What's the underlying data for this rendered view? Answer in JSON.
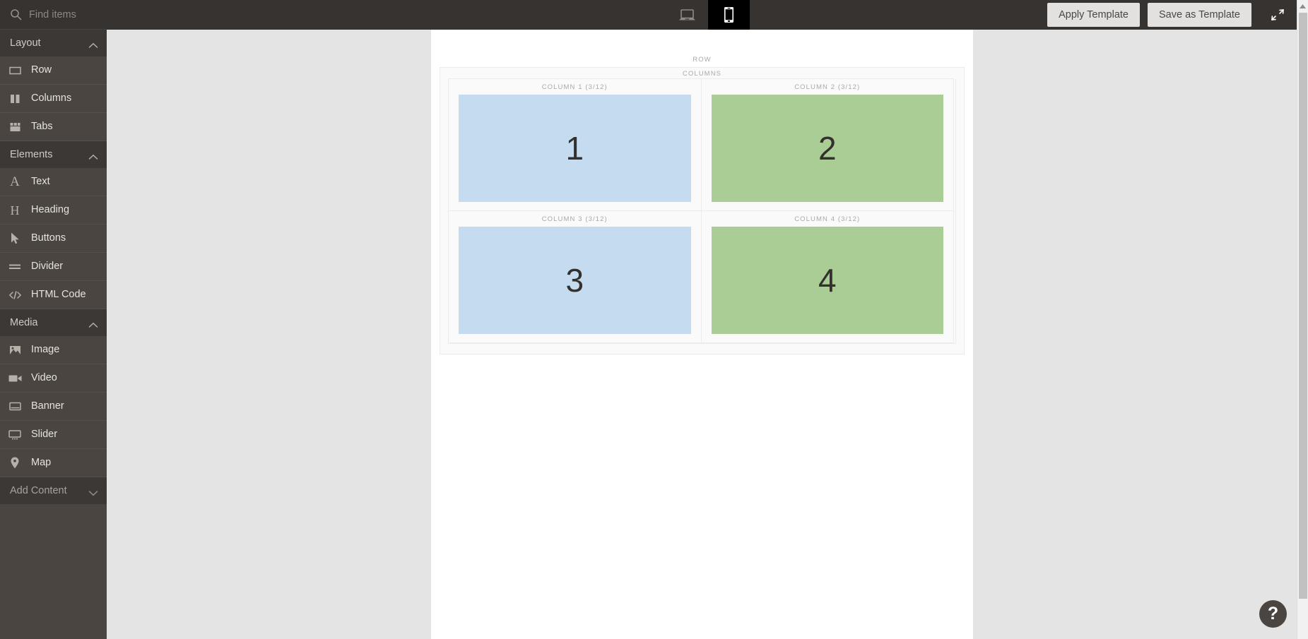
{
  "topbar": {
    "search": {
      "placeholder": "Find items",
      "value": "",
      "icon": "search-icon"
    },
    "viewport": {
      "desktop": {
        "label": "Desktop",
        "icon": "laptop-icon",
        "active": false
      },
      "mobile": {
        "label": "Mobile",
        "icon": "phone-icon",
        "active": true
      }
    },
    "apply_template_label": "Apply Template",
    "save_template_label": "Save as Template",
    "collapse_icon": "collapse-arrows-icon"
  },
  "sidebar": {
    "groups": [
      {
        "title": "Layout",
        "collapsed": false,
        "chevron": "chevron-up-icon",
        "items": [
          {
            "label": "Row",
            "icon": "row-icon"
          },
          {
            "label": "Columns",
            "icon": "columns-icon"
          },
          {
            "label": "Tabs",
            "icon": "tabs-icon"
          }
        ]
      },
      {
        "title": "Elements",
        "collapsed": false,
        "chevron": "chevron-up-icon",
        "items": [
          {
            "label": "Text",
            "icon": "text-a-icon"
          },
          {
            "label": "Heading",
            "icon": "heading-h-icon"
          },
          {
            "label": "Buttons",
            "icon": "cursor-arrow-icon"
          },
          {
            "label": "Divider",
            "icon": "divider-icon"
          },
          {
            "label": "HTML Code",
            "icon": "code-icon"
          }
        ]
      },
      {
        "title": "Media",
        "collapsed": false,
        "chevron": "chevron-up-icon",
        "items": [
          {
            "label": "Image",
            "icon": "image-icon"
          },
          {
            "label": "Video",
            "icon": "video-camera-icon"
          },
          {
            "label": "Banner",
            "icon": "banner-icon"
          },
          {
            "label": "Slider",
            "icon": "slider-icon"
          },
          {
            "label": "Map",
            "icon": "map-pin-icon"
          }
        ]
      },
      {
        "title": "Add Content",
        "collapsed": true,
        "chevron": "chevron-down-icon",
        "items": []
      }
    ]
  },
  "canvas": {
    "row_label": "ROW",
    "columns_label": "COLUMNS",
    "columns": [
      {
        "title": "COLUMN 1 (3/12)",
        "content": "1",
        "color": "blue",
        "hex": "#c5dcf0"
      },
      {
        "title": "COLUMN 2 (3/12)",
        "content": "2",
        "color": "green",
        "hex": "#a9cd94"
      },
      {
        "title": "COLUMN 3 (3/12)",
        "content": "3",
        "color": "blue",
        "hex": "#c5dcf0"
      },
      {
        "title": "COLUMN 4 (3/12)",
        "content": "4",
        "color": "green",
        "hex": "#a9cd94"
      }
    ]
  },
  "help": {
    "label": "?",
    "icon": "question-mark-icon"
  },
  "colors": {
    "topbar_bg": "#363330",
    "sidebar_bg": "#4a4541",
    "group_head_bg": "#3b3835",
    "workarea_bg": "#e4e4e4",
    "canvas_bg": "#ffffff",
    "accent_blue": "#c5dcf0",
    "accent_green": "#a9cd94"
  }
}
